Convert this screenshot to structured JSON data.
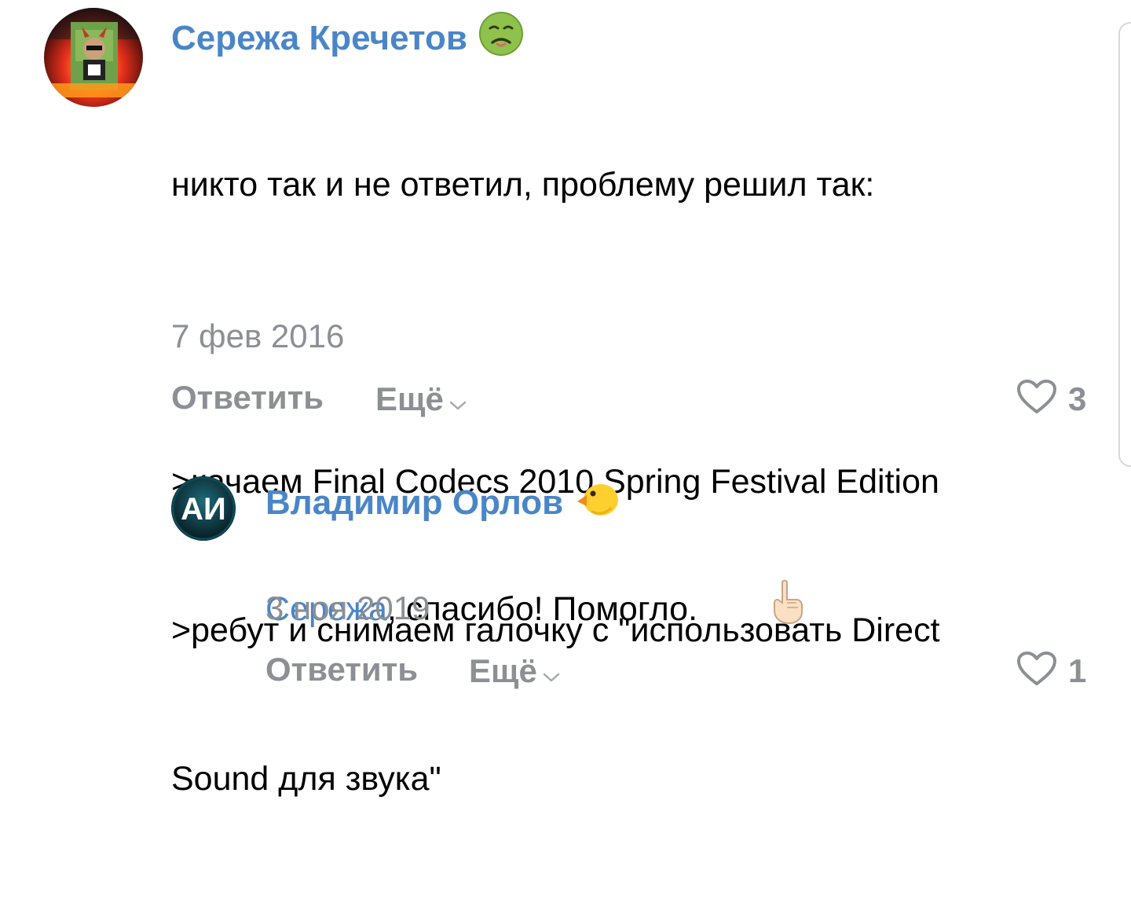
{
  "colors": {
    "name": "#4a86c7",
    "text": "#000000",
    "meta": "#8c8f94",
    "action": "#8c8f94",
    "mention": "#4a86c7"
  },
  "comments": [
    {
      "author": "Сережа Кречетов",
      "author_emoji": "nauseated-face-emoji",
      "avatar": "avatar-photo",
      "lines": [
        "никто так и не ответил, проблему решил так:",
        "",
        ">качаем Final Codecs 2010 Spring Festival Edition",
        ">ребут и снимаем галочку с \"использовать Direct",
        "Sound для звука\""
      ],
      "date": "7 фев 2016",
      "reply_label": "Ответить",
      "more_label": "Ещё",
      "likes": "3"
    },
    {
      "author": "Владимир Орлов",
      "author_emoji": "chick-emoji",
      "avatar_text": "АИ",
      "mention": "Сережа",
      "text_after_mention": ", спасибо! Помогло.",
      "text_emoji": "pointing-up-emoji",
      "date": "3 ноя 2019",
      "reply_label": "Ответить",
      "more_label": "Ещё",
      "likes": "1"
    }
  ]
}
